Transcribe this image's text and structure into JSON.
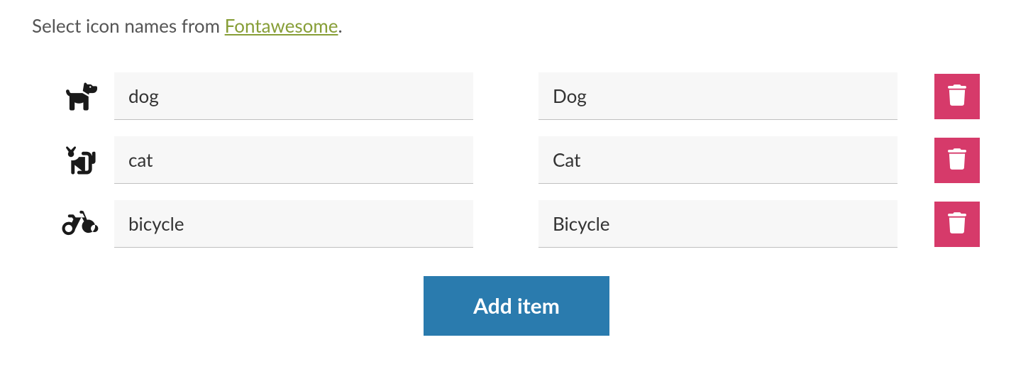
{
  "description": {
    "prefix": "Select icon names from ",
    "link_text": "Fontawesome",
    "suffix": "."
  },
  "rows": [
    {
      "icon": "dog",
      "name": "dog",
      "label": "Dog"
    },
    {
      "icon": "cat",
      "name": "cat",
      "label": "Cat"
    },
    {
      "icon": "bicycle",
      "name": "bicycle",
      "label": "Bicycle"
    }
  ],
  "add_button_label": "Add item",
  "colors": {
    "link": "#879e37",
    "delete": "#d63a6a",
    "primary": "#2a7bae"
  }
}
